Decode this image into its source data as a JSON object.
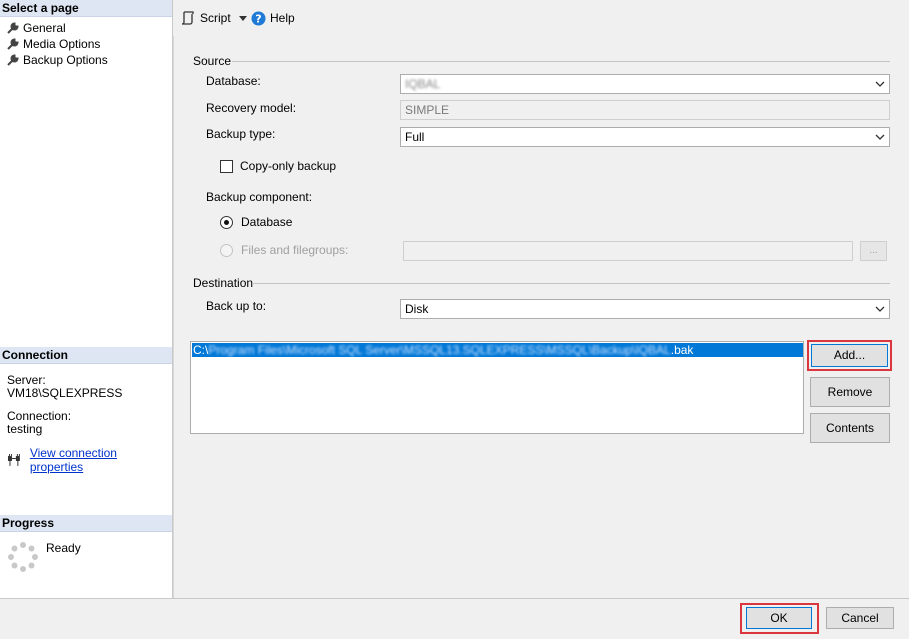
{
  "left_pane": {
    "select_page_header": "Select a page",
    "pages": [
      {
        "label": "General"
      },
      {
        "label": "Media Options"
      },
      {
        "label": "Backup Options"
      }
    ],
    "connection_header": "Connection",
    "server_label": "Server:",
    "server_value": "VM18\\SQLEXPRESS",
    "connection_label": "Connection:",
    "connection_value": "testing",
    "view_connection_link": "View connection properties",
    "progress_header": "Progress",
    "progress_status": "Ready"
  },
  "toolbar": {
    "script_label": "Script",
    "help_label": "Help"
  },
  "source": {
    "group_title": "Source",
    "database_label": "Database:",
    "database_value": "IQBAL",
    "recovery_label": "Recovery model:",
    "recovery_value": "SIMPLE",
    "backup_type_label": "Backup type:",
    "backup_type_value": "Full",
    "copy_only_label": "Copy-only backup",
    "copy_only_checked": false,
    "component_label": "Backup component:",
    "component_database": "Database",
    "component_files": "Files and filegroups:",
    "component_selected": "Database",
    "browse_button": "..."
  },
  "destination": {
    "group_title": "Destination",
    "back_up_to_label": "Back up to:",
    "back_up_to_value": "Disk",
    "path_visible_prefix": "C:\\",
    "path_blurred": "Program Files\\Microsoft SQL Server\\MSSQL13.SQLEXPRESS\\MSSQL\\Backup\\IQBAL",
    "path_suffix": ".bak",
    "add_button": "Add...",
    "remove_button": "Remove",
    "contents_button": "Contents"
  },
  "footer": {
    "ok_button": "OK",
    "cancel_button": "Cancel"
  },
  "colors": {
    "highlight": "#d9363e",
    "selection": "#0078d7",
    "section_header": "#dde6f2"
  }
}
